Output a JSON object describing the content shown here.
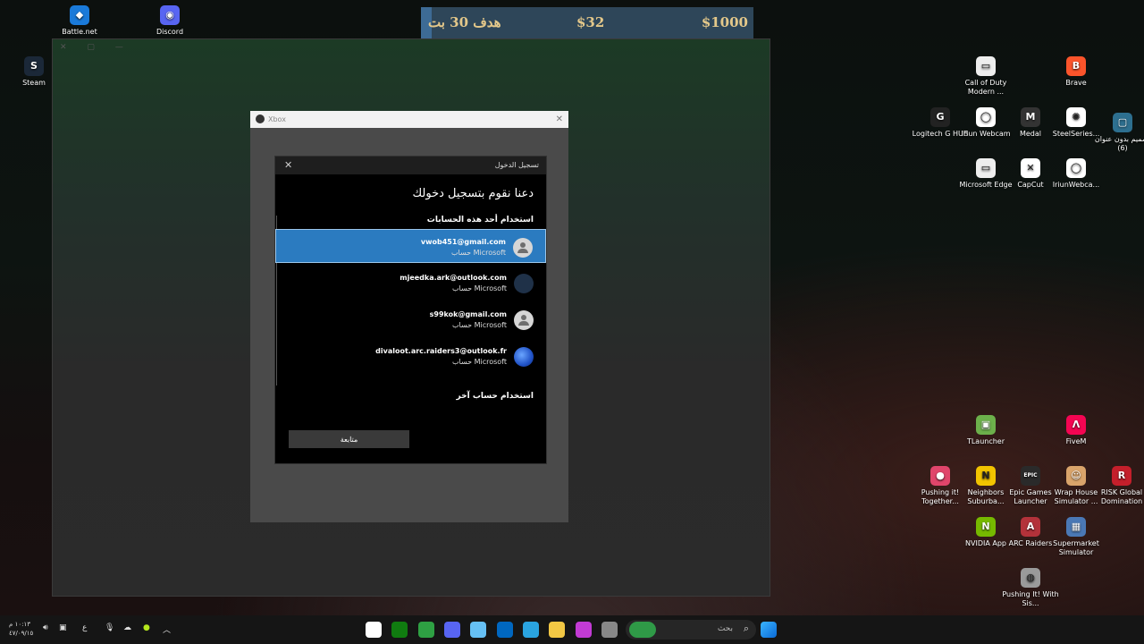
{
  "banner": {
    "left": "$1000",
    "mid": "$32",
    "right": "هدف 30 بت"
  },
  "desktop_left": [
    {
      "label": "Battle.net",
      "glyph": "◆",
      "color": "#1a7ad9"
    },
    {
      "label": "Discord",
      "glyph": "◉",
      "color": "#5865f2"
    },
    {
      "label": "Steam",
      "glyph": "S",
      "color": "#1b2838"
    }
  ],
  "desktop_right": [
    {
      "label": "Call of Duty Modern ...",
      "glyph": "▭",
      "color": "#eeeeee"
    },
    {
      "label": "Brave",
      "glyph": "B",
      "color": "#fb542b"
    },
    {
      "label": "Logitech G HUB",
      "glyph": "G",
      "color": "#222222"
    },
    {
      "label": "Iriun Webcam",
      "glyph": "◯",
      "color": "#ffffff"
    },
    {
      "label": "Medal",
      "glyph": "M",
      "color": "#333333"
    },
    {
      "label": "SteelSeries...",
      "glyph": "✺",
      "color": "#ffffff"
    },
    {
      "label": "تصميم بدون عنوان (6)",
      "glyph": "▢",
      "color": "#2d6f8f"
    },
    {
      "label": "Microsoft Edge",
      "glyph": "▭",
      "color": "#eeeeee"
    },
    {
      "label": "CapCut",
      "glyph": "✕",
      "color": "#ffffff"
    },
    {
      "label": "IriunWebca...",
      "glyph": "◯",
      "color": "#ffffff"
    },
    {
      "label": "TLauncher",
      "glyph": "▣",
      "color": "#6cb04b"
    },
    {
      "label": "FiveM",
      "glyph": "Λ",
      "color": "#f40552"
    },
    {
      "label": "Pushing it! Together...",
      "glyph": "●",
      "color": "#e0456b"
    },
    {
      "label": "Neighbors Suburba...",
      "glyph": "N",
      "color": "#f2c400"
    },
    {
      "label": "Epic Games Launcher",
      "glyph": "EPIC",
      "color": "#2a2a2a"
    },
    {
      "label": "Wrap House Simulator ...",
      "glyph": "☺",
      "color": "#d9a46b"
    },
    {
      "label": "RISK Global Domination",
      "glyph": "R",
      "color": "#c41f2b"
    },
    {
      "label": "NVIDIA App",
      "glyph": "N",
      "color": "#76b900"
    },
    {
      "label": "ARC Raiders",
      "glyph": "A",
      "color": "#b3323a"
    },
    {
      "label": "Supermarket Simulator",
      "glyph": "▦",
      "color": "#4a78b5"
    },
    {
      "label": "Pushing It! With Sis...",
      "glyph": "◍",
      "color": "#9a9a9a"
    }
  ],
  "xbox_window": {
    "title": "Xbox"
  },
  "dialog": {
    "header": "تسجيل الدخول",
    "heading": "دعنا نقوم بتسجيل دخولك",
    "accounts_section": "استخدام أحد هذه الحسابات",
    "accounts": [
      {
        "email": "vwob451@gmail.com",
        "type": "حساب Microsoft",
        "avatar": "person",
        "selected": true
      },
      {
        "email": "mjeedka.ark@outlook.com",
        "type": "حساب Microsoft",
        "avatar": "blue",
        "selected": false
      },
      {
        "email": "s99kok@gmail.com",
        "type": "حساب Microsoft",
        "avatar": "person",
        "selected": false
      },
      {
        "email": "divaloot.arc.raiders3@outlook.fr",
        "type": "حساب Microsoft",
        "avatar": "globe",
        "selected": false
      }
    ],
    "other_section": "استخدام حساب آخر",
    "continue": "متابعة"
  },
  "taskbar": {
    "search_placeholder": "بحث",
    "time": "١٠:١٣ م",
    "date": "٤٧/٠٩/١٥",
    "lang": "ع",
    "apps": [
      {
        "name": "xbox-app",
        "color": "#ffffff"
      },
      {
        "name": "xbox-green",
        "color": "#107c10"
      },
      {
        "name": "app-green",
        "color": "#2ea043"
      },
      {
        "name": "discord",
        "color": "#5865f2"
      },
      {
        "name": "steam",
        "color": "#66c0f4"
      },
      {
        "name": "store",
        "color": "#0067c0"
      },
      {
        "name": "edge",
        "color": "#2aa4e0"
      },
      {
        "name": "files",
        "color": "#f2c744"
      },
      {
        "name": "m365",
        "color": "#c23bd4"
      },
      {
        "name": "window",
        "color": "#888888"
      }
    ]
  }
}
